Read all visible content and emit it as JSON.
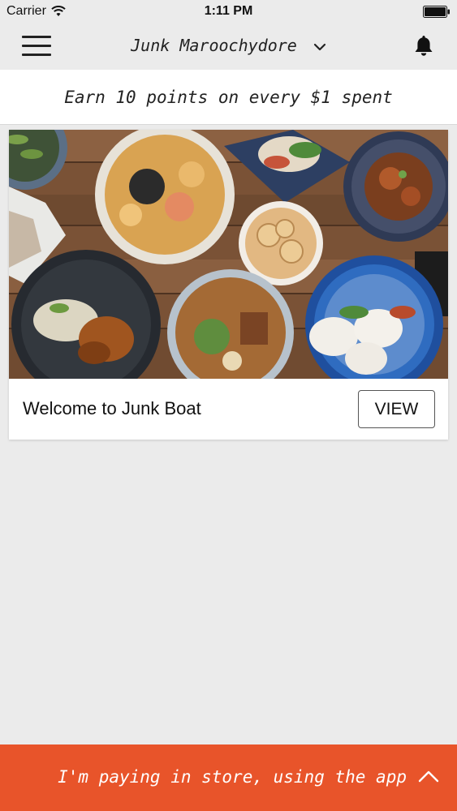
{
  "status_bar": {
    "carrier": "Carrier",
    "time": "1:11 PM",
    "wifi_icon": "wifi-icon",
    "battery_icon": "battery-icon"
  },
  "nav": {
    "menu_icon": "hamburger-menu-icon",
    "location": "Junk Maroochydore",
    "location_chevron": "chevron-down-icon",
    "notifications_icon": "bell-icon"
  },
  "points_banner": {
    "text": "Earn 10 points on every $1 spent"
  },
  "card": {
    "image": "food-spread-photo",
    "title": "Welcome to Junk Boat",
    "button_label": "VIEW"
  },
  "pay_bar": {
    "label": "I'm paying in store, using the app",
    "icon": "chevron-up-icon",
    "color": "#e8542a"
  }
}
